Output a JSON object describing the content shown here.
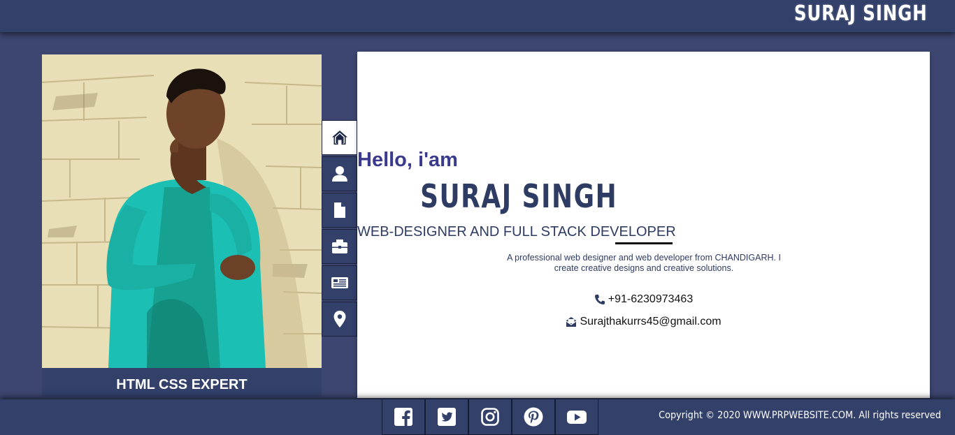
{
  "header": {
    "brand": "SURAJ SINGH"
  },
  "profile": {
    "caption": "HTML CSS EXPERT",
    "photo_alt": "portrait photo"
  },
  "side_nav": [
    {
      "icon": "home-icon",
      "active": true
    },
    {
      "icon": "user-icon",
      "active": false
    },
    {
      "icon": "file-icon",
      "active": false
    },
    {
      "icon": "briefcase-icon",
      "active": false
    },
    {
      "icon": "newspaper-icon",
      "active": false
    },
    {
      "icon": "map-marker-icon",
      "active": false
    }
  ],
  "intro": {
    "greeting": "Hello, i'am",
    "name": "SURAJ SINGH",
    "role": "WEB-DESIGNER AND FULL STACK DEVELOPER",
    "description": "A professional web designer and web developer from CHANDIGARH. I create creative designs and creative solutions.",
    "phone": "+91-6230973463",
    "email": "Surajthakurrs45@gmail.com"
  },
  "footer": {
    "social": [
      "facebook-icon",
      "twitter-icon",
      "instagram-icon",
      "pinterest-icon",
      "youtube-icon"
    ],
    "copyright": "Copyright © 2020 WWW.PRPWEBSITE.COM. All rights reserved"
  },
  "colors": {
    "navy": "#32406a",
    "page_bg": "#3c4670",
    "accent_text": "#3b3b8e",
    "white": "#ffffff"
  }
}
